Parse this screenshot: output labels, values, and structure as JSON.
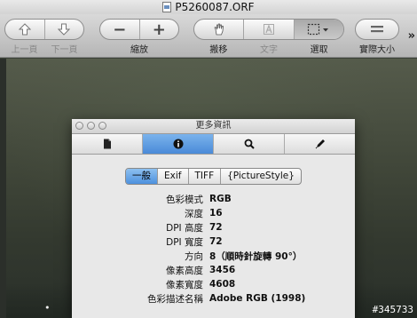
{
  "window": {
    "title": "P5260087.ORF"
  },
  "toolbar": {
    "nav": {
      "prev": "上一頁",
      "next": "下一頁"
    },
    "zoom": {
      "label": "縮放",
      "out_symbol": "−",
      "in_symbol": "+"
    },
    "tools": {
      "move": "搬移",
      "text": "文字",
      "select": "選取"
    },
    "actual_size": "實際大小",
    "more": "»"
  },
  "inspector": {
    "title": "更多資訊",
    "subtabs": [
      "一般",
      "Exif",
      "TIFF",
      "{PictureStyle}"
    ],
    "active_subtab": "一般",
    "rows": [
      {
        "key": "色彩模式",
        "value": "RGB"
      },
      {
        "key": "深度",
        "value": "16"
      },
      {
        "key": "DPI 高度",
        "value": "72"
      },
      {
        "key": "DPI 寬度",
        "value": "72"
      },
      {
        "key": "方向",
        "value": "8（順時針旋轉 90°）"
      },
      {
        "key": "像素高度",
        "value": "3456"
      },
      {
        "key": "像素寬度",
        "value": "4608"
      },
      {
        "key": "色彩描述名稱",
        "value": "Adobe RGB (1998)"
      }
    ]
  },
  "watermark": "#345733",
  "colors": {
    "accent": "#4a8ad8",
    "toolbar": "#c8c8c8"
  }
}
